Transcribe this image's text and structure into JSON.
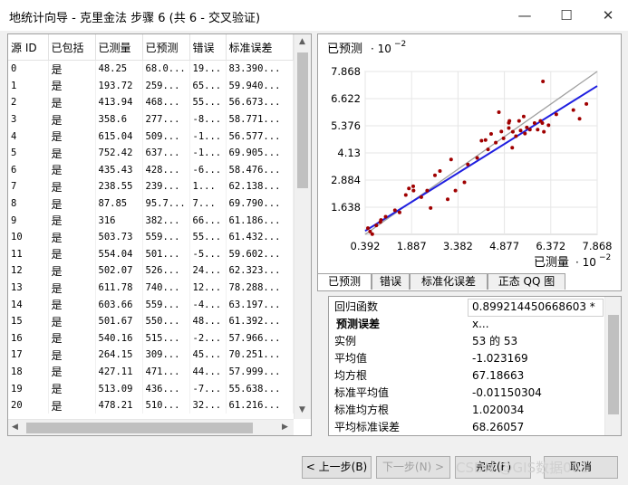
{
  "window": {
    "title": "地统计向导 - 克里金法 步骤 6 (共 6 - 交叉验证)",
    "min": "—",
    "max": "☐",
    "close": "✕"
  },
  "table": {
    "columns": [
      "源 ID",
      "已包括",
      "已测量",
      "已预测",
      "错误",
      "标准误差"
    ],
    "rows": [
      [
        "0",
        "是",
        "48.25",
        "68.0...",
        "19...",
        "83.390..."
      ],
      [
        "1",
        "是",
        "193.72",
        "259...",
        "65...",
        "59.940..."
      ],
      [
        "2",
        "是",
        "413.94",
        "468...",
        "55...",
        "56.673..."
      ],
      [
        "3",
        "是",
        "358.6",
        "277...",
        "-8...",
        "58.771..."
      ],
      [
        "4",
        "是",
        "615.04",
        "509...",
        "-1...",
        "56.577..."
      ],
      [
        "5",
        "是",
        "752.42",
        "637...",
        "-1...",
        "69.905..."
      ],
      [
        "6",
        "是",
        "435.43",
        "428...",
        "-6...",
        "58.476..."
      ],
      [
        "7",
        "是",
        "238.55",
        "239...",
        "1...",
        "62.138..."
      ],
      [
        "8",
        "是",
        "87.85",
        "95.7...",
        "7...",
        "69.790..."
      ],
      [
        "9",
        "是",
        "316",
        "382...",
        "66...",
        "61.186..."
      ],
      [
        "10",
        "是",
        "503.73",
        "559...",
        "55...",
        "61.432..."
      ],
      [
        "11",
        "是",
        "554.04",
        "501...",
        "-5...",
        "59.602..."
      ],
      [
        "12",
        "是",
        "502.07",
        "526...",
        "24...",
        "62.323..."
      ],
      [
        "13",
        "是",
        "611.78",
        "740...",
        "12...",
        "78.288..."
      ],
      [
        "14",
        "是",
        "603.66",
        "559...",
        "-4...",
        "63.197..."
      ],
      [
        "15",
        "是",
        "501.67",
        "550...",
        "48...",
        "61.392..."
      ],
      [
        "16",
        "是",
        "540.16",
        "515...",
        "-2...",
        "57.966..."
      ],
      [
        "17",
        "是",
        "264.15",
        "309...",
        "45...",
        "70.251..."
      ],
      [
        "18",
        "是",
        "427.11",
        "471...",
        "44...",
        "57.999..."
      ],
      [
        "19",
        "是",
        "513.09",
        "436...",
        "-7...",
        "55.638..."
      ],
      [
        "20",
        "是",
        "478.21",
        "510...",
        "32...",
        "61.216..."
      ]
    ]
  },
  "chart_data": {
    "type": "scatter",
    "ylabel": "已预测",
    "xlabel": "已测量",
    "y_scale_note": "· 10^-2",
    "x_scale_note": "· 10^-2",
    "xlim": [
      0.392,
      7.868
    ],
    "ylim": [
      0.392,
      7.868
    ],
    "xticks": [
      "0.392",
      "1.887",
      "3.382",
      "4.877",
      "6.372",
      "7.868"
    ],
    "yticks": [
      "1.638",
      "2.884",
      "4.13",
      "5.376",
      "6.622",
      "7.868"
    ],
    "points": [
      [
        0.48,
        0.68
      ],
      [
        1.94,
        2.6
      ],
      [
        4.14,
        4.69
      ],
      [
        3.59,
        2.78
      ],
      [
        6.15,
        5.1
      ],
      [
        7.52,
        6.38
      ],
      [
        4.35,
        4.29
      ],
      [
        2.39,
        2.4
      ],
      [
        0.88,
        0.96
      ],
      [
        3.16,
        3.83
      ],
      [
        5.04,
        5.6
      ],
      [
        5.54,
        5.02
      ],
      [
        5.02,
        5.27
      ],
      [
        6.12,
        7.41
      ],
      [
        6.04,
        5.6
      ],
      [
        5.02,
        5.51
      ],
      [
        5.4,
        5.16
      ],
      [
        2.64,
        3.1
      ],
      [
        4.27,
        4.72
      ],
      [
        5.13,
        4.37
      ],
      [
        4.78,
        5.11
      ],
      [
        0.55,
        0.52
      ],
      [
        0.62,
        0.4
      ],
      [
        0.75,
        0.8
      ],
      [
        0.9,
        1.05
      ],
      [
        1.05,
        1.2
      ],
      [
        1.35,
        1.5
      ],
      [
        1.5,
        1.4
      ],
      [
        1.7,
        2.2
      ],
      [
        1.8,
        2.5
      ],
      [
        1.95,
        2.4
      ],
      [
        2.2,
        2.1
      ],
      [
        2.5,
        1.6
      ],
      [
        2.8,
        3.3
      ],
      [
        3.05,
        2.0
      ],
      [
        3.3,
        2.4
      ],
      [
        3.7,
        3.6
      ],
      [
        4.0,
        3.9
      ],
      [
        4.45,
        5.0
      ],
      [
        4.6,
        4.6
      ],
      [
        4.7,
        6.0
      ],
      [
        4.85,
        4.8
      ],
      [
        5.15,
        5.1
      ],
      [
        5.25,
        4.9
      ],
      [
        5.35,
        5.6
      ],
      [
        5.5,
        5.8
      ],
      [
        5.6,
        5.3
      ],
      [
        5.7,
        5.2
      ],
      [
        5.85,
        5.5
      ],
      [
        5.95,
        5.2
      ],
      [
        6.1,
        5.5
      ],
      [
        6.3,
        5.4
      ],
      [
        6.55,
        5.9
      ],
      [
        7.1,
        6.1
      ],
      [
        7.3,
        5.7
      ]
    ],
    "reference_line_color": "#a0a0a0",
    "regression_color": "#1f1fe0",
    "point_color": "#a00000"
  },
  "tabs": [
    "已预测",
    "错误",
    "标准化误差",
    "正态 QQ 图"
  ],
  "stats": {
    "regression_label": "回归函数",
    "regression_value": "0.899214450668603 * x...",
    "header": "预测误差",
    "rows": [
      {
        "label": "实例",
        "value": "53 的 53"
      },
      {
        "label": "平均值",
        "value": "-1.023169"
      },
      {
        "label": "均方根",
        "value": "67.18663"
      },
      {
        "label": "标准平均值",
        "value": "-0.01150304"
      },
      {
        "label": "标准均方根",
        "value": "1.020034"
      },
      {
        "label": "平均标准误差",
        "value": "68.26057"
      }
    ]
  },
  "buttons": {
    "back": "< 上一步(B)",
    "next": "下一步(N) >",
    "finish": "完成(F)",
    "cancel": "取消"
  },
  "watermark": "CSDN @GIS数据001"
}
